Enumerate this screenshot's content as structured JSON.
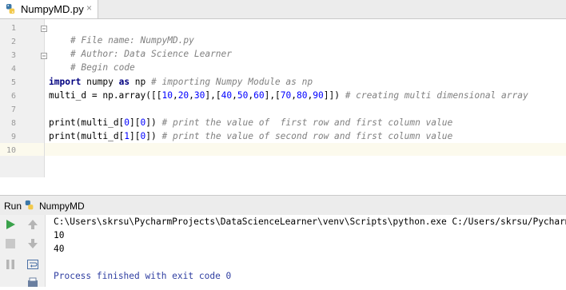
{
  "tab": {
    "title": "NumpyMD.py",
    "close": "×"
  },
  "editor": {
    "line_numbers": [
      "1",
      "2",
      "3",
      "4",
      "5",
      "6",
      "7",
      "8",
      "9",
      "10"
    ],
    "lines": {
      "l1": {
        "comment": "# File name: NumpyMD.py"
      },
      "l2": {
        "comment": "# Author: Data Science Learner"
      },
      "l3": {
        "comment": "# Begin code"
      },
      "l5": {
        "kw1": "import",
        "mod": " numpy ",
        "kw2": "as",
        "alias": " np ",
        "comment": "# importing Numpy Module as np"
      },
      "l6": {
        "a": "multi_d = np.array([[",
        "n1": "10",
        "c1": ",",
        "n2": "20",
        "c2": ",",
        "n3": "30",
        "c3": "],[",
        "n4": "40",
        "c4": ",",
        "n5": "50",
        "c5": ",",
        "n6": "60",
        "c6": "],[",
        "n7": "70",
        "c7": ",",
        "n8": "80",
        "c8": ",",
        "n9": "90",
        "c9": "]]) ",
        "comment": "# creating multi dimensional array"
      },
      "l8": {
        "a": "print(multi_d[",
        "n1": "0",
        "b": "][",
        "n2": "0",
        "c": "]) ",
        "comment": "# print the value of  first row and first column value"
      },
      "l9": {
        "a": "print(multi_d[",
        "n1": "1",
        "b": "][",
        "n2": "0",
        "c": "]) ",
        "comment": "# print the value of second row and first column value"
      }
    }
  },
  "run": {
    "label": "Run",
    "config": "NumpyMD",
    "console": {
      "command": "C:\\Users\\skrsu\\PycharmProjects\\DataScienceLearner\\venv\\Scripts\\python.exe C:/Users/skrsu/PycharmProjects/DataScienceLearner/NumpyMD.py",
      "output1": "10",
      "output2": "40",
      "finished": "Process finished with exit code 0"
    }
  },
  "colors": {
    "comment": "#808080",
    "keyword": "#000080",
    "number": "#0000ff",
    "caret_row": "#fcfaed",
    "run_green": "#3aa24b"
  }
}
